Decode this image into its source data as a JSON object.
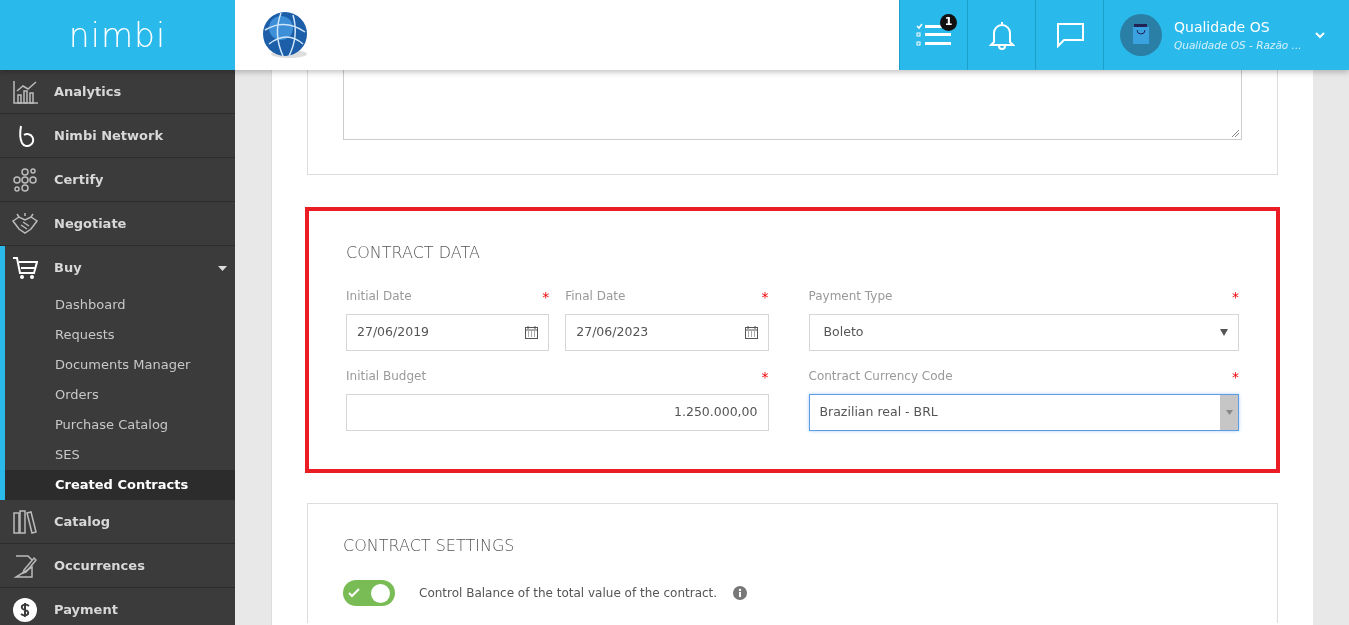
{
  "brand": "nimbi",
  "header": {
    "tasks_badge": "1",
    "user": {
      "name": "Qualidade OS",
      "subtitle": "Qualidade OS - Razão ..."
    }
  },
  "sidebar": {
    "items": [
      {
        "label": "Analytics",
        "selected": false
      },
      {
        "label": "Nimbi Network",
        "selected": false
      },
      {
        "label": "Certify",
        "selected": false
      },
      {
        "label": "Negotiate",
        "selected": false
      },
      {
        "label": "Buy",
        "expanded": true,
        "selected": false,
        "children": [
          {
            "label": "Dashboard",
            "selected": false
          },
          {
            "label": "Requests",
            "selected": false
          },
          {
            "label": "Documents Manager",
            "selected": false
          },
          {
            "label": "Orders",
            "selected": false
          },
          {
            "label": "Purchase Catalog",
            "selected": false
          },
          {
            "label": "SES",
            "selected": false
          },
          {
            "label": "Created Contracts",
            "selected": true
          }
        ]
      },
      {
        "label": "Catalog",
        "selected": false
      },
      {
        "label": "Occurrences",
        "selected": false
      },
      {
        "label": "Payment",
        "selected": false
      }
    ]
  },
  "contract_data": {
    "title": "CONTRACT DATA",
    "highlighted": true,
    "fields": [
      {
        "kind": "date",
        "label": "Initial Date",
        "required_mark": "*",
        "value": "27/06/2019",
        "focused": false
      },
      {
        "kind": "date",
        "label": "Final Date",
        "required_mark": "*",
        "value": "27/06/2023",
        "focused": false
      },
      {
        "kind": "select",
        "label": "Payment Type",
        "required_mark": "*",
        "value": "Boleto",
        "focused": false
      },
      {
        "kind": "number",
        "label": "Initial Budget",
        "required_mark": "*",
        "value": "1.250.000,00",
        "focused": false
      },
      {
        "kind": "combo",
        "label": "Contract Currency Code",
        "required_mark": "*",
        "value": "Brazilian real - BRL",
        "focused": true
      }
    ]
  },
  "contract_settings": {
    "title": "CONTRACT SETTINGS",
    "toggles": [
      {
        "label": "Control Balance of the total value of the contract.",
        "on": true,
        "info": true
      }
    ]
  }
}
